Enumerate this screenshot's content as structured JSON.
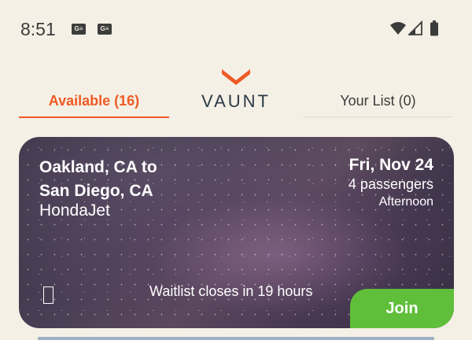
{
  "status_bar": {
    "time": "8:51",
    "notification_icons": [
      "G≡",
      "G≡"
    ]
  },
  "header": {
    "tab_available": "Available (16)",
    "logo_text": "VAUNT",
    "tab_your_list": "Your List (0)"
  },
  "flight_card": {
    "route_line1": "Oakland, CA to",
    "route_line2": "San Diego, CA",
    "aircraft": "HondaJet",
    "date": "Fri, Nov 24",
    "passengers": "4 passengers",
    "time_of_day": "Afternoon",
    "waitlist_text": "Waitlist closes in 19 hours",
    "join_label": "Join"
  },
  "colors": {
    "accent": "#ef5a24",
    "join_green": "#5fbf3a",
    "background": "#f5f0e6",
    "logo_navy": "#2b3947"
  }
}
